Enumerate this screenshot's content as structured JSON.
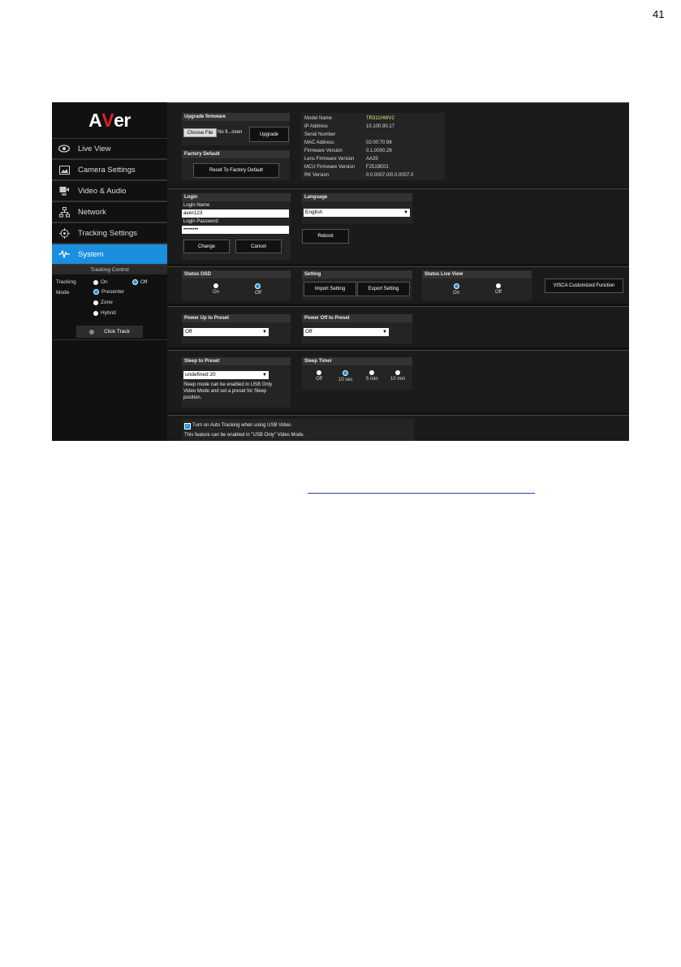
{
  "page_number": "41",
  "brand": {
    "logo_text_a": "A",
    "logo_text_v": "V",
    "logo_text_er": "er"
  },
  "sidebar": {
    "items": [
      {
        "label": "Live View",
        "icon": "eye-icon"
      },
      {
        "label": "Camera Settings",
        "icon": "image-icon"
      },
      {
        "label": "Video & Audio",
        "icon": "video-audio-icon"
      },
      {
        "label": "Network",
        "icon": "network-icon"
      },
      {
        "label": "Tracking Settings",
        "icon": "crosshair-icon"
      },
      {
        "label": "System",
        "icon": "pulse-icon",
        "active": true
      }
    ],
    "tracking_control": {
      "title": "Tracking Control",
      "tracking_label": "Tracking",
      "on": "On",
      "off": "Off",
      "mode_label": "Mode",
      "presenter": "Presenter",
      "zone": "Zone",
      "hybrid": "Hybrid",
      "click_track": "Click Track"
    }
  },
  "upgrade": {
    "title": "Upgrade firmware",
    "choose_file": "Choose File",
    "no_file": "No fi...osen",
    "upgrade_button": "Upgrade"
  },
  "factory": {
    "title": "Factory Default",
    "reset_button": "Reset To Factory Default"
  },
  "info": {
    "rows": [
      {
        "label": "Model Name",
        "value": "TR311HWV2"
      },
      {
        "label": "IP Address",
        "value": "10.100.90.17"
      },
      {
        "label": "Serial Number",
        "value": ""
      },
      {
        "label": "MAC Address",
        "value": "02:00:70:96"
      },
      {
        "label": "Firmware Version",
        "value": "0.1.0000.28"
      },
      {
        "label": "Lens Firmware Version",
        "value": "AA35"
      },
      {
        "label": "MCU Firmware Version",
        "value": "F2519E01"
      },
      {
        "label": "RK Version",
        "value": "0.0.0007.0/0.0.0007.0"
      }
    ]
  },
  "login": {
    "title": "Login",
    "name_label": "Login Name",
    "name_value": "aver123",
    "password_label": "Login Password",
    "password_value": "••••••••",
    "change_button": "Change",
    "cancel_button": "Cancel"
  },
  "language": {
    "title": "Language",
    "selected": "English",
    "reboot_button": "Reboot"
  },
  "status_osd": {
    "title": "Status OSD",
    "on": "On",
    "off": "Off",
    "selected": "Off"
  },
  "setting": {
    "title": "Setting",
    "import_button": "Import Setting",
    "export_button": "Export Setting"
  },
  "status_live_view": {
    "title": "Status Live View",
    "on": "On",
    "off": "Off",
    "selected": "On"
  },
  "visca_button": "VISCA Customized Function",
  "power_up": {
    "title": "Power Up to Preset",
    "selected": "Off"
  },
  "power_off": {
    "title": "Power Off to Preset",
    "selected": "Off"
  },
  "sleep_preset": {
    "title": "Sleep to Preset",
    "selected": "undefined 20",
    "note_1": "Sleep mode can be enabled in USB Only",
    "note_2": "Video Mode and set a preset for Sleep",
    "note_3": "position."
  },
  "sleep_timer": {
    "title": "Sleep Timer",
    "options": [
      "Off",
      "10 sec",
      "5 min",
      "10 min"
    ],
    "selected": "10 sec"
  },
  "auto_tracking": {
    "label": "Turn on Auto Tracking when using USB Video",
    "note": "This feature can be enabled in \"USB Only\" Video Mode."
  }
}
